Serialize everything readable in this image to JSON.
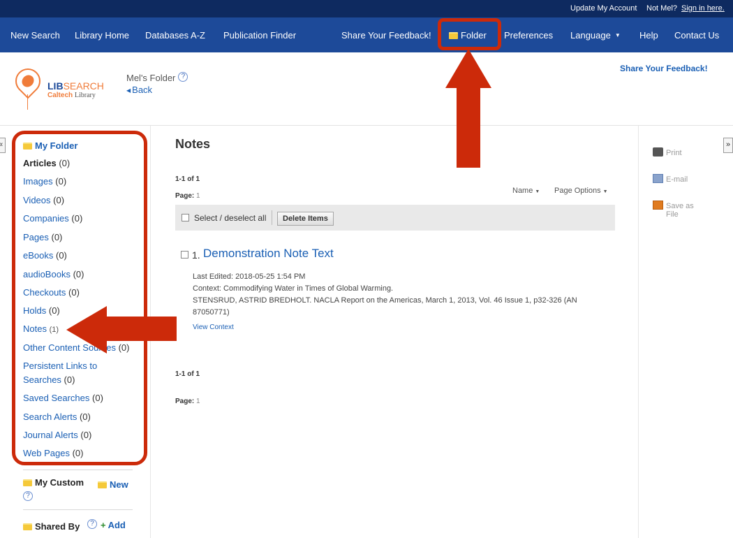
{
  "topstrip": {
    "update_account": "Update My Account",
    "not_user": "Not Mel?",
    "sign_in": "Sign in here."
  },
  "nav": {
    "new_search": "New Search",
    "library_home": "Library Home",
    "databases": "Databases A-Z",
    "publication_finder": "Publication Finder",
    "feedback": "Share Your Feedback!",
    "folder": "Folder",
    "preferences": "Preferences",
    "language": "Language",
    "help": "Help",
    "contact": "Contact Us"
  },
  "header": {
    "logo_lib": "LIB",
    "logo_search": "SEARCH",
    "logo_caltech": "Caltech",
    "logo_library": "Library",
    "folder_title": "Mel's Folder",
    "help_mark": "?",
    "back": "Back",
    "feedback": "Share Your Feedback!"
  },
  "sidebar": {
    "expand_left": "«",
    "my_folder": "My Folder",
    "items": [
      {
        "label": "Articles",
        "count": "(0)"
      },
      {
        "label": "Images",
        "count": "(0)"
      },
      {
        "label": "Videos",
        "count": "(0)"
      },
      {
        "label": "Companies",
        "count": "(0)"
      },
      {
        "label": "Pages",
        "count": "(0)"
      },
      {
        "label": "eBooks",
        "count": "(0)"
      },
      {
        "label": "audioBooks",
        "count": "(0)"
      },
      {
        "label": "Checkouts",
        "count": "(0)"
      },
      {
        "label": "Holds",
        "count": "(0)"
      },
      {
        "label": "Notes",
        "count": "(1)"
      },
      {
        "label": "Other Content Sources",
        "count": "(0)"
      },
      {
        "label": "Persistent Links to",
        "count": ""
      },
      {
        "label": "Searches",
        "count": "(0)"
      },
      {
        "label": "Saved Searches",
        "count": "(0)"
      },
      {
        "label": "Search Alerts",
        "count": "(0)"
      },
      {
        "label": "Journal Alerts",
        "count": "(0)"
      },
      {
        "label": "Web Pages",
        "count": "(0)"
      }
    ],
    "my_custom": "My Custom",
    "new": "New",
    "shared_by": "Shared By",
    "add": "Add"
  },
  "main": {
    "title": "Notes",
    "results_count": "1-1 of 1",
    "page_label": "Page:",
    "page_num": "1",
    "sort_name": "Name",
    "page_options": "Page Options",
    "select_all": "Select / deselect all",
    "delete_items": "Delete Items",
    "result": {
      "number": "1.",
      "title": "Demonstration Note Text",
      "last_edited": "Last Edited: 2018-05-25 1:54 PM",
      "context": "Context: Commodifying Water in Times of Global Warming.",
      "citation": "STENSRUD, ASTRID BREDHOLT. NACLA Report on the Americas, March 1, 2013, Vol. 46 Issue 1, p32-326 (AN",
      "citation_cont": "87050771)",
      "view_context": "View Context"
    }
  },
  "tools": {
    "expand_right": "»",
    "print": "Print",
    "email": "E-mail",
    "save_as": "Save as",
    "file": "File"
  }
}
